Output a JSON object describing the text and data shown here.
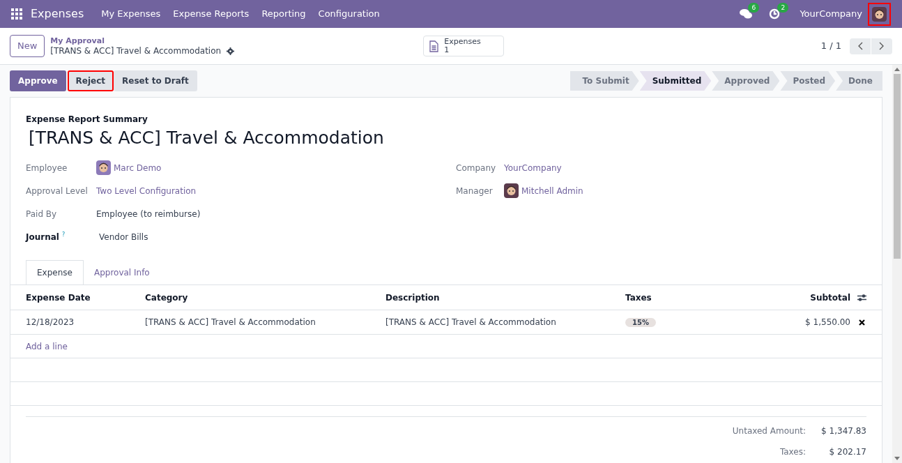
{
  "navbar": {
    "app_name": "Expenses",
    "menu": [
      "My Expenses",
      "Expense Reports",
      "Reporting",
      "Configuration"
    ],
    "messages_count": "6",
    "activities_count": "2",
    "company": "YourCompany",
    "avatar_highlighted": true
  },
  "control_panel": {
    "new_button": "New",
    "breadcrumb": "My Approval",
    "record_title": "[TRANS & ACC] Travel & Accommodation",
    "smart_button": {
      "label": "Expenses",
      "count": "1"
    },
    "pager": "1 / 1"
  },
  "actions": [
    {
      "label": "Approve",
      "kind": "primary",
      "highlighted": false
    },
    {
      "label": "Reject",
      "kind": "secondary",
      "highlighted": true
    },
    {
      "label": "Reset to Draft",
      "kind": "secondary",
      "highlighted": false
    }
  ],
  "stages": [
    {
      "label": "To Submit",
      "selected": false
    },
    {
      "label": "Submitted",
      "selected": true
    },
    {
      "label": "Approved",
      "selected": false
    },
    {
      "label": "Posted",
      "selected": false
    },
    {
      "label": "Done",
      "selected": false
    }
  ],
  "form": {
    "subtitle": "Expense Report Summary",
    "title": "[TRANS & ACC] Travel & Accommodation",
    "left_fields": [
      {
        "label": "Employee",
        "value": "Marc Demo",
        "kind": "avatar_link",
        "bold": false
      },
      {
        "label": "Approval Level",
        "value": "Two Level Configuration",
        "kind": "link",
        "bold": false
      },
      {
        "label": "Paid By",
        "value": "Employee (to reimburse)",
        "kind": "text",
        "bold": false
      },
      {
        "label": "Journal",
        "value": "Vendor Bills",
        "kind": "text",
        "bold": true,
        "help": "?"
      }
    ],
    "right_fields": [
      {
        "label": "Company",
        "value": "YourCompany",
        "kind": "link",
        "bold": false
      },
      {
        "label": "Manager",
        "value": "Mitchell Admin",
        "kind": "avatar_link",
        "bold": false
      }
    ]
  },
  "tabs": [
    {
      "label": "Expense",
      "selected": true
    },
    {
      "label": "Approval Info",
      "selected": false
    }
  ],
  "table": {
    "columns": [
      "Expense Date",
      "Category",
      "Description",
      "Taxes",
      "Subtotal"
    ],
    "rows": [
      {
        "date": "12/18/2023",
        "category": "[TRANS & ACC] Travel & Accommodation",
        "description": "[TRANS & ACC] Travel & Accommodation",
        "tax": "15%",
        "subtotal": "$ 1,550.00"
      }
    ],
    "add_line": "Add a line"
  },
  "totals": [
    {
      "label": "Untaxed Amount:",
      "value": "$ 1,347.83"
    },
    {
      "label": "Taxes:",
      "value": "$ 202.17"
    }
  ]
}
